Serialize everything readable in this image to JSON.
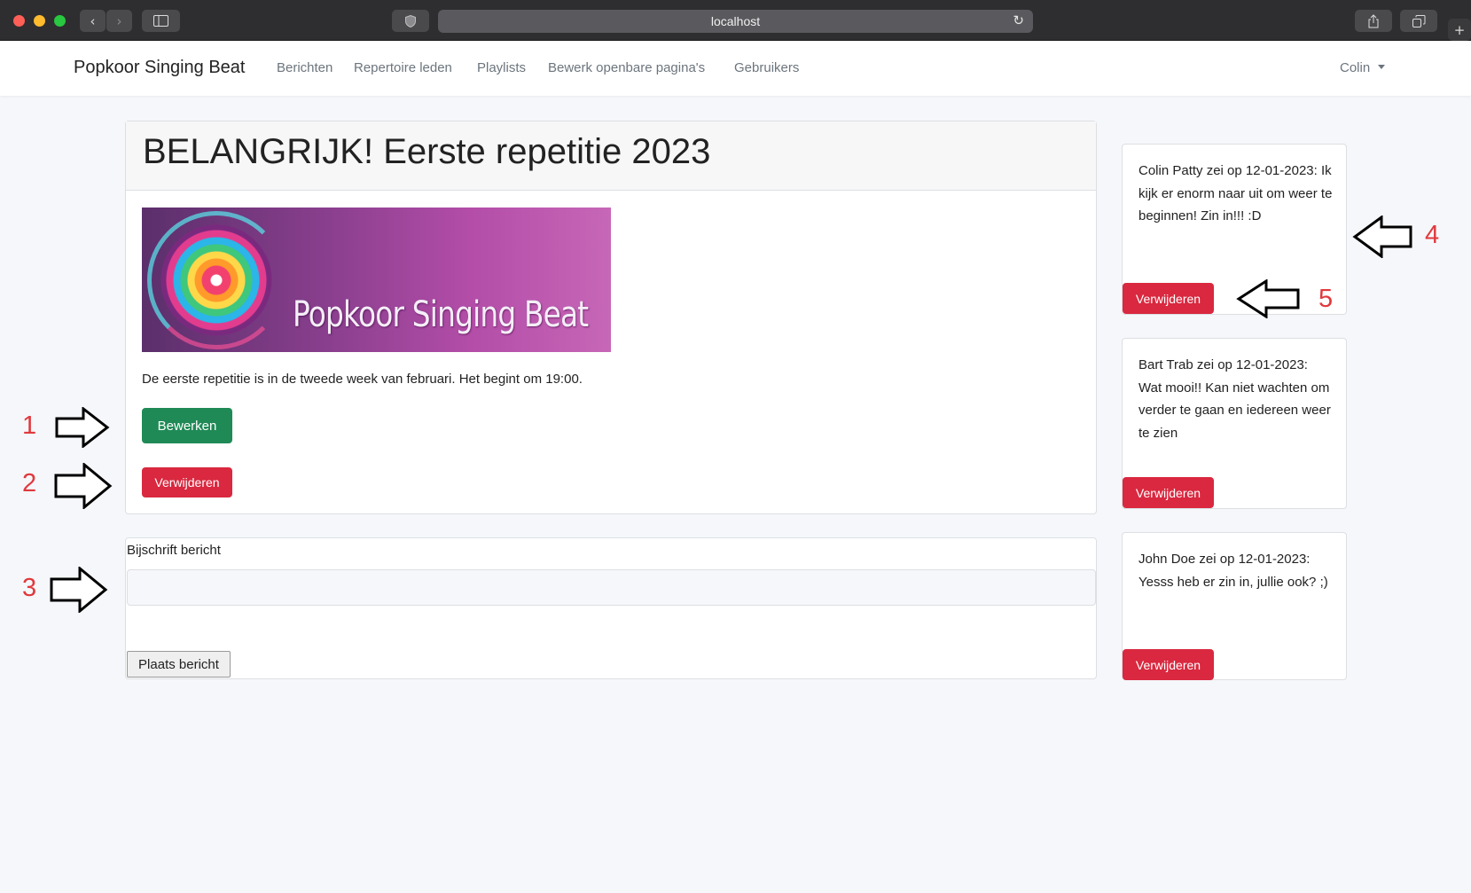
{
  "browser": {
    "url": "localhost",
    "back_icon": "chevron-left-icon",
    "forward_icon": "chevron-right-icon",
    "sidebar_icon": "sidebar-icon",
    "privacy_icon": "shield-icon",
    "reload_icon": "reload-icon",
    "share_icon": "share-icon",
    "tabs_icon": "tabs-icon",
    "new_tab_icon": "plus-icon"
  },
  "navbar": {
    "brand": "Popkoor Singing Beat",
    "links": [
      "Berichten",
      "Repertoire leden",
      "Playlists",
      "Bewerk openbare pagina's",
      "Gebruikers"
    ],
    "user": "Colin"
  },
  "post": {
    "title": "BELANGRIJK! Eerste repetitie 2023",
    "banner_text": "Popkoor Singing Beat",
    "body": "De eerste repetitie is in de tweede week van februari. Het begint om 19:00.",
    "edit_label": "Bewerken",
    "delete_label": "Verwijderen"
  },
  "form": {
    "label": "Bijschrift bericht",
    "input_value": "",
    "submit_label": "Plaats bericht"
  },
  "comments": [
    {
      "text": "Colin Patty zei op 12-01-2023: Ik kijk er enorm naar uit om weer te beginnen! Zin in!!! :D",
      "delete_label": "Verwijderen"
    },
    {
      "text": "Bart Trab zei op 12-01-2023: Wat mooi!! Kan niet wachten om verder te gaan en iedereen weer te zien",
      "delete_label": "Verwijderen"
    },
    {
      "text": "John Doe zei op 12-01-2023: Yesss heb er zin in, jullie ook? ;)",
      "delete_label": "Verwijderen"
    }
  ],
  "annotations": [
    "1",
    "2",
    "3",
    "4",
    "5"
  ],
  "colors": {
    "primary_green": "#1f8a56",
    "danger_red": "#d9283f",
    "annotation_red": "#e0393d"
  }
}
